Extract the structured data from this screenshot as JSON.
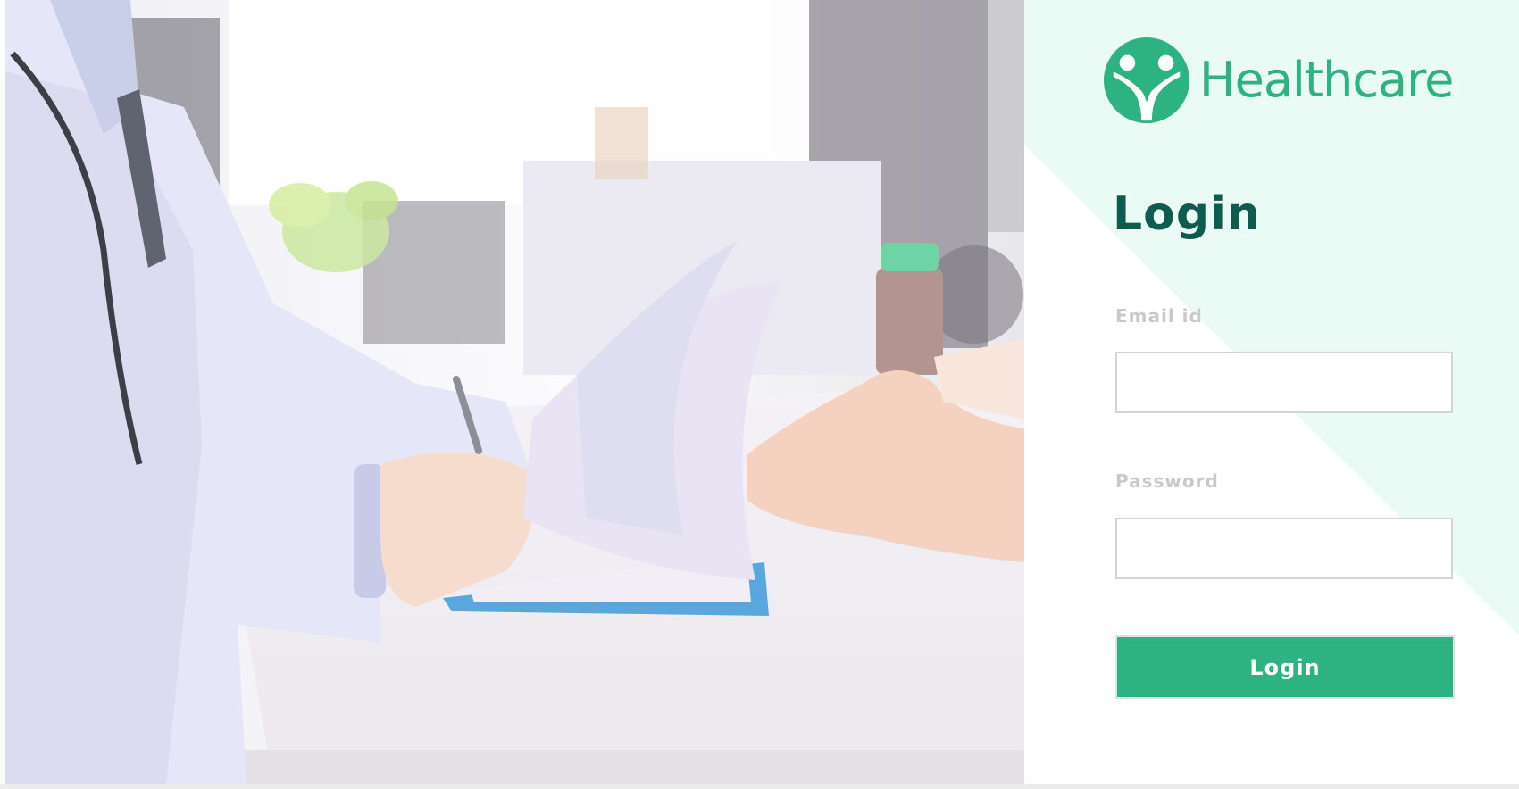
{
  "brand": {
    "name": "Healthcare",
    "logo_icon": "people-circle-logo-icon",
    "color": "#2db382"
  },
  "hero": {
    "image_subject": "doctor-writing-notes-photo"
  },
  "login_form": {
    "title": "Login",
    "email_label": "Email id",
    "email_value": "",
    "password_label": "Password",
    "password_value": "",
    "submit_label": "Login"
  },
  "colors": {
    "accent": "#2db382",
    "title": "#0e5b4f",
    "panel_tint": "#e9fbf4",
    "label": "#c9c9c9"
  }
}
